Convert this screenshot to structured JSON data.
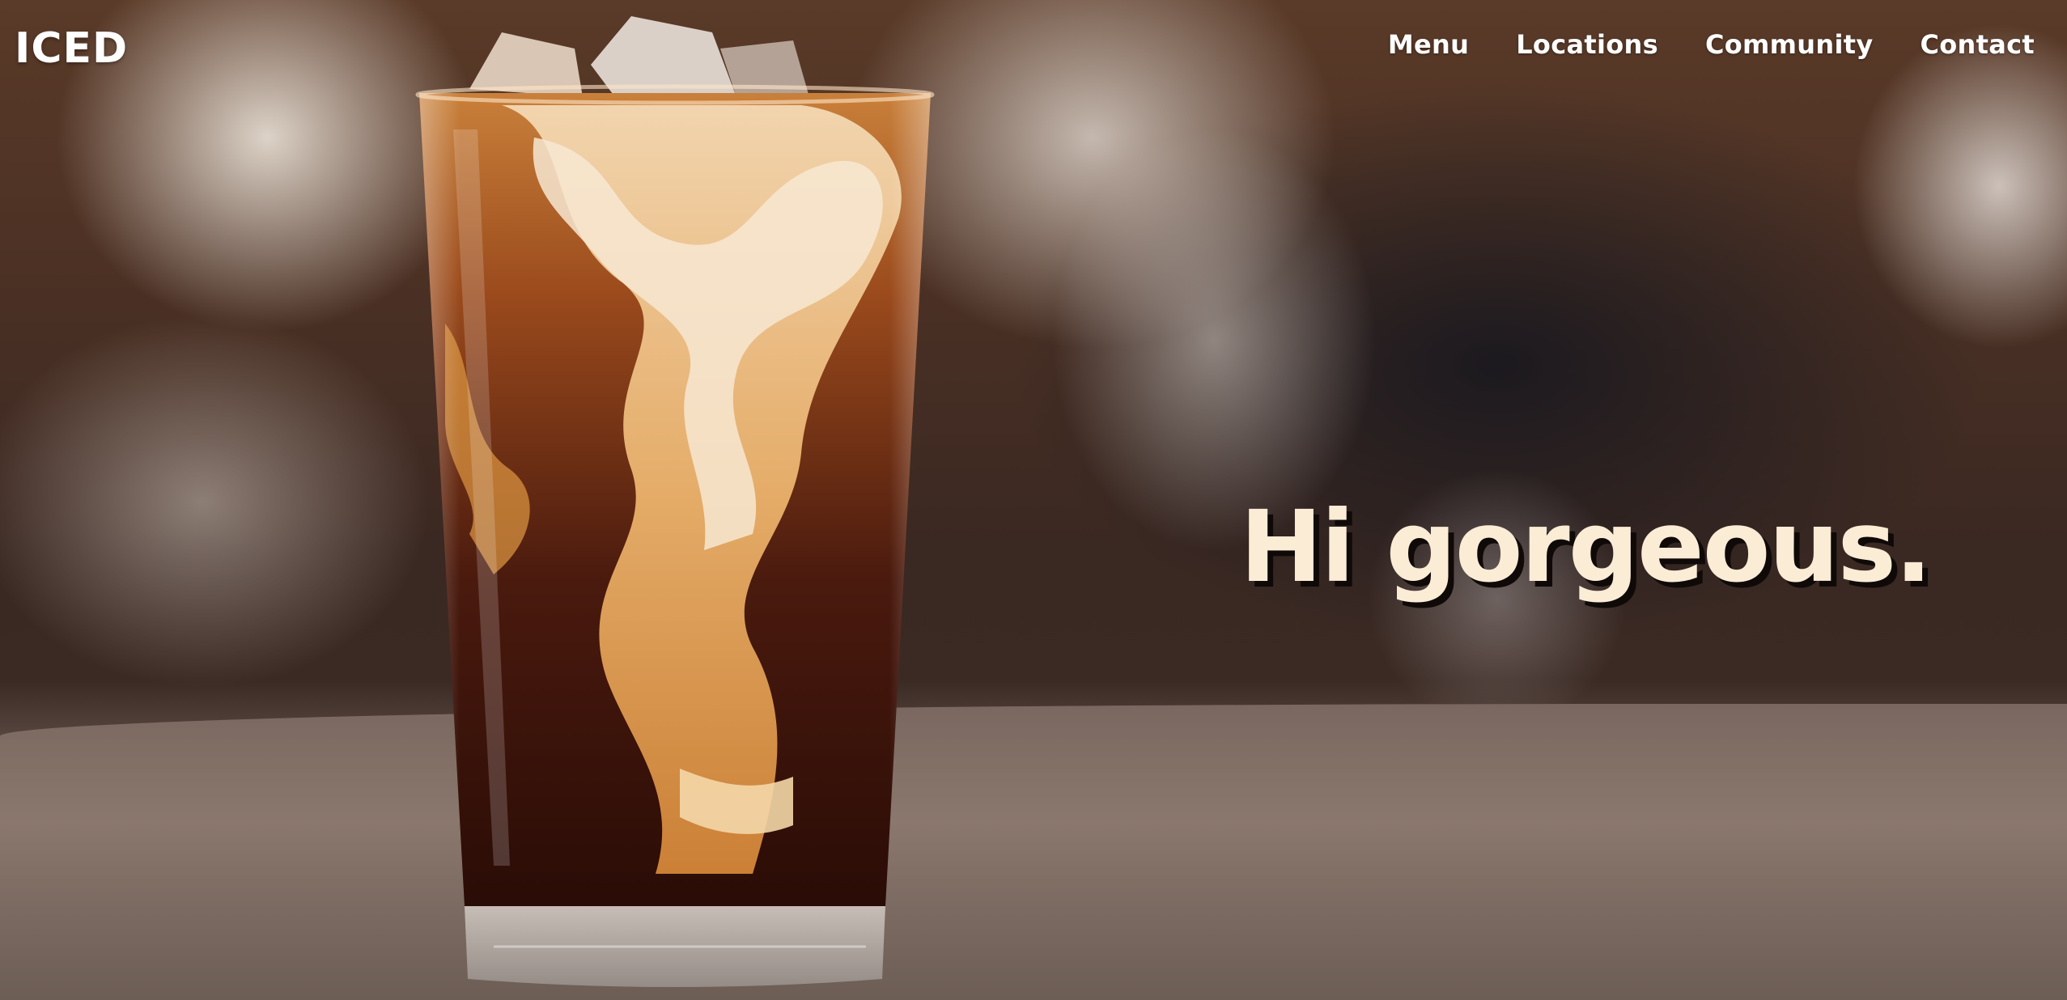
{
  "brand": {
    "logo": "ICED"
  },
  "nav": {
    "items": [
      {
        "label": "Menu"
      },
      {
        "label": "Locations"
      },
      {
        "label": "Community"
      },
      {
        "label": "Contact"
      }
    ]
  },
  "hero": {
    "headline": "Hi gorgeous.",
    "headline_color": "#fbecd6",
    "background_image": "iced-coffee-glass-photo"
  }
}
